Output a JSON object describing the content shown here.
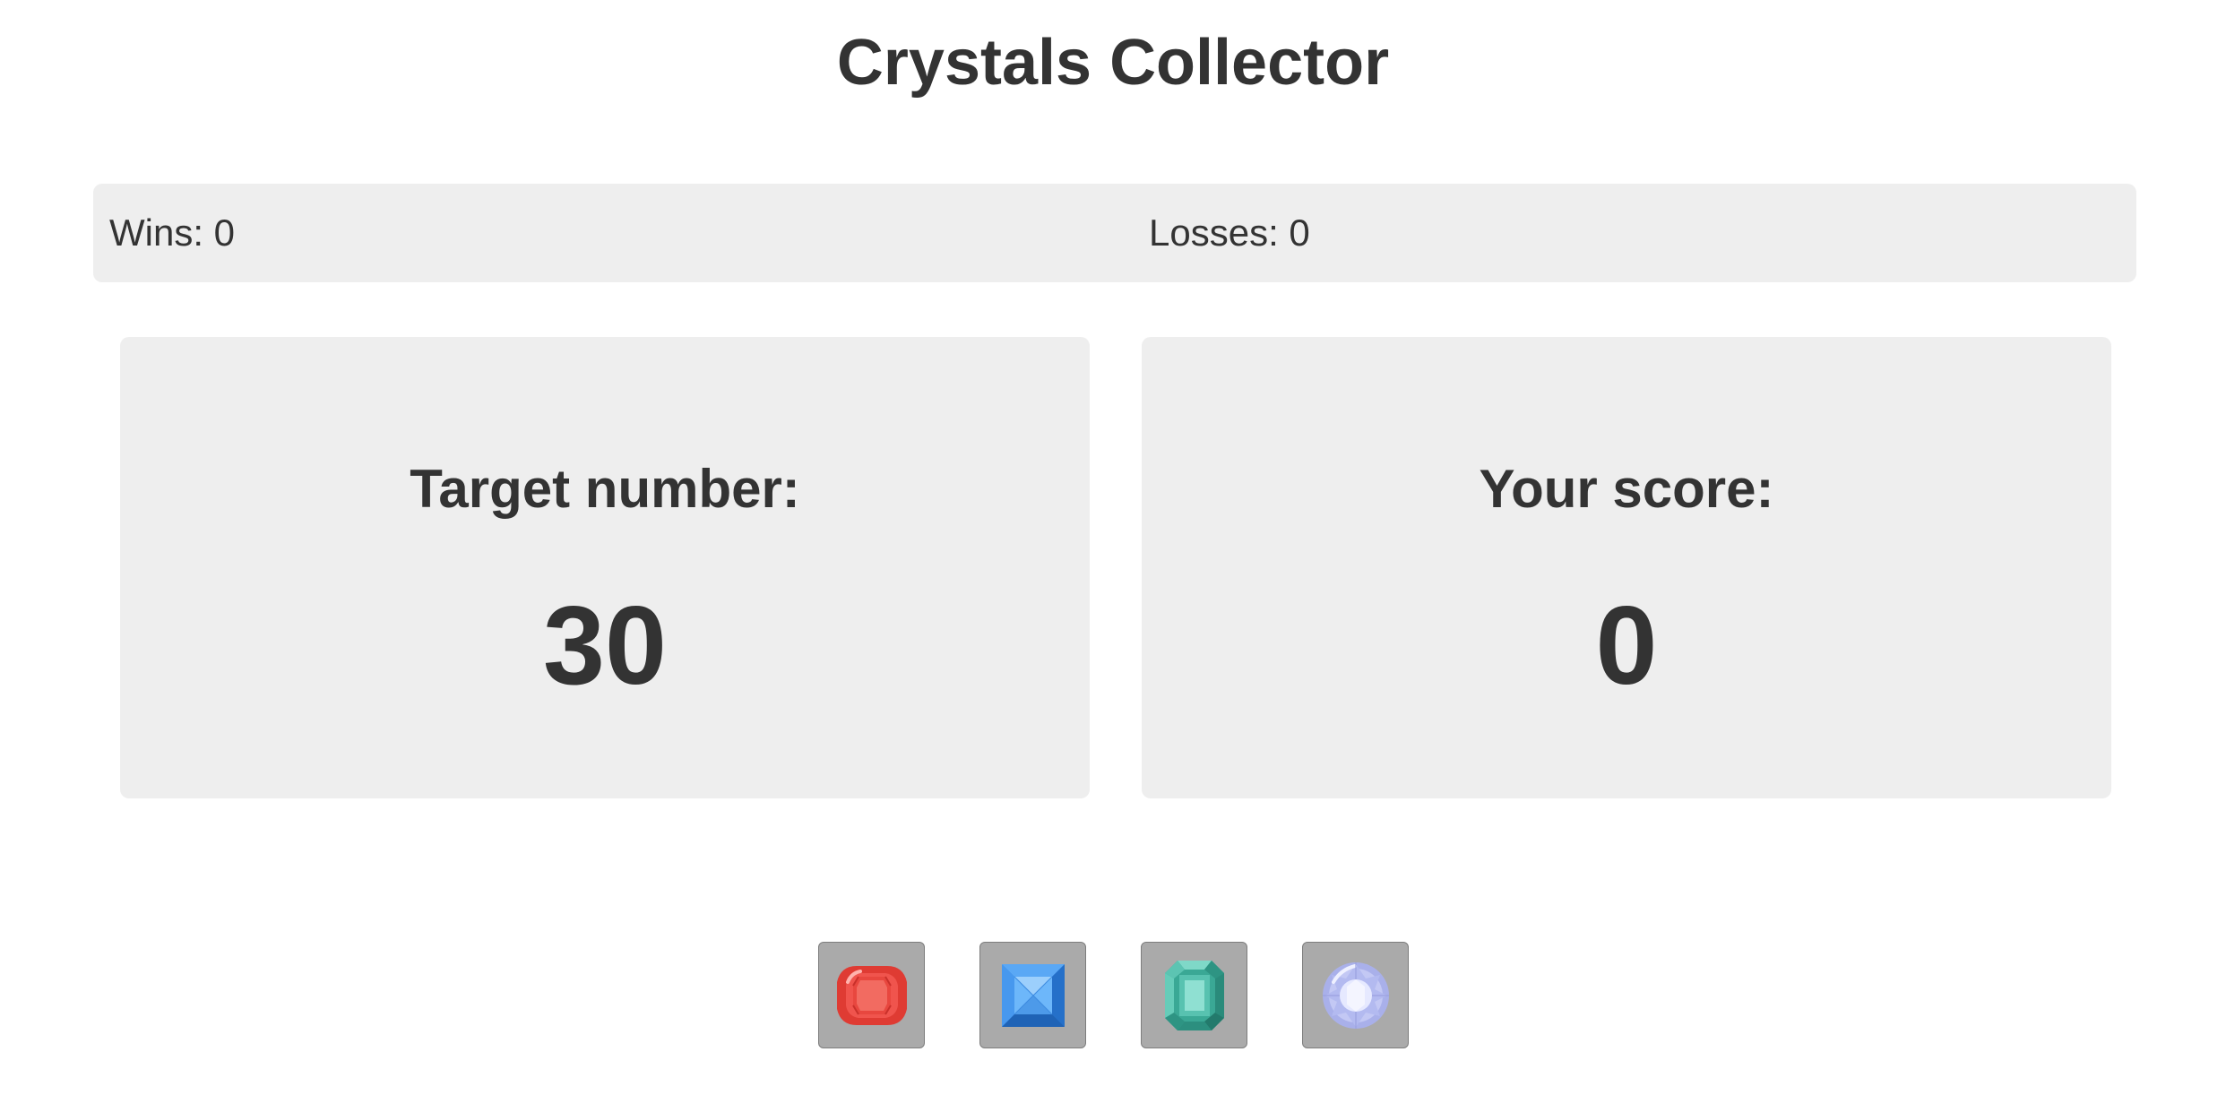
{
  "header": {
    "title": "Crystals Collector"
  },
  "record": {
    "wins": "Wins: 0",
    "losses": "Losses: 0"
  },
  "target": {
    "label": "Target number:",
    "value": "30"
  },
  "score": {
    "label": "Your score:",
    "value": "0"
  },
  "crystals": [
    {
      "icon": "red-crystal-icon",
      "color": "#e4433c"
    },
    {
      "icon": "blue-crystal-icon",
      "color": "#3b8ee6"
    },
    {
      "icon": "green-crystal-icon",
      "color": "#4fbfae"
    },
    {
      "icon": "purple-crystal-icon",
      "color": "#b7bdf0"
    }
  ]
}
